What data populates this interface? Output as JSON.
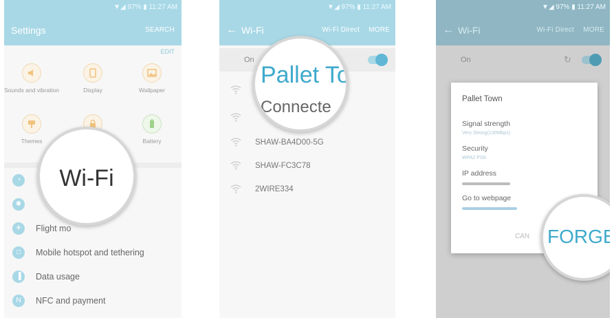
{
  "panel1": {
    "status": "▼◢ 97% ▮ 11:27 AM",
    "title": "Settings",
    "search": "SEARCH",
    "edit": "EDIT",
    "grid": [
      {
        "label": "Sounds and vibration",
        "icon": "speaker-icon"
      },
      {
        "label": "Display",
        "icon": "display-icon"
      },
      {
        "label": "Wallpaper",
        "icon": "wallpaper-icon"
      },
      {
        "label": "Themes",
        "icon": "theme-icon"
      },
      {
        "label": "",
        "icon": "lock-icon"
      },
      {
        "label": "Battery",
        "icon": "battery-icon"
      }
    ],
    "list": [
      {
        "label": "",
        "icon": "wifi-icon"
      },
      {
        "label": "",
        "icon": "bluetooth-icon"
      },
      {
        "label": "Flight mo",
        "icon": "airplane-icon"
      },
      {
        "label": "Mobile hotspot and tethering",
        "icon": "hotspot-icon"
      },
      {
        "label": "Data usage",
        "icon": "data-usage-icon"
      },
      {
        "label": "NFC and payment",
        "icon": "nfc-icon"
      }
    ],
    "magnifier_text": "Wi-Fi"
  },
  "panel2": {
    "status": "▼◢ 97% ▮ 11:27 AM",
    "title": "Wi-Fi",
    "wifi_direct": "Wi-Fi Direct",
    "more": "MORE",
    "on_label": "On",
    "networks": [
      "SHAW-BA4D00-5G",
      "SHAW-FC3C78",
      "2WIRE334"
    ],
    "magnifier": {
      "name": "Pallet To",
      "status": "Connecte"
    }
  },
  "panel3": {
    "status": "▼◢ 97% ▮ 11:27 AM",
    "title": "Wi-Fi",
    "wifi_direct": "Wi-Fi Direct",
    "more": "MORE",
    "on_label": "On",
    "dialog": {
      "title": "Pallet Town",
      "signal_label": "Signal strength",
      "signal_value": "Very Strong(130Mbps)",
      "security_label": "Security",
      "security_value": "WPA2 PSK",
      "ip_label": "IP address",
      "web_label": "Go to webpage",
      "cancel": "CAN"
    },
    "magnifier_text": "FORGET"
  },
  "colors": {
    "accent": "#a8d8e6",
    "accent_dark": "#3ea9cc",
    "bg": "#f7f7f7"
  }
}
